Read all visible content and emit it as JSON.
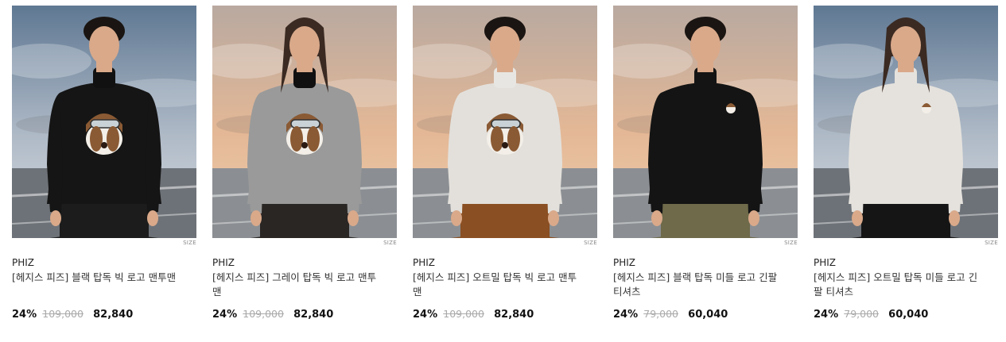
{
  "products": [
    {
      "brand": "PHIZ",
      "title": "[헤지스 피즈] 블랙 탑독 빅 로고 맨투맨",
      "discount": "24%",
      "original_price": "109,000",
      "price": "82,840",
      "size_label": "SIZE",
      "sky": "blue",
      "top_color": "#151515",
      "collar_color": "#111111",
      "bottom_color": "#1c1c1c",
      "logo": "big",
      "gender": "m"
    },
    {
      "brand": "PHIZ",
      "title": "[헤지스 피즈] 그레이 탑독 빅 로고 맨투맨",
      "discount": "24%",
      "original_price": "109,000",
      "price": "82,840",
      "size_label": "SIZE",
      "sky": "pink",
      "top_color": "#9a9a9a",
      "collar_color": "#111111",
      "bottom_color": "#2a2624",
      "logo": "big",
      "gender": "f"
    },
    {
      "brand": "PHIZ",
      "title": "[헤지스 피즈] 오트밀 탑독 빅 로고 맨투맨",
      "discount": "24%",
      "original_price": "109,000",
      "price": "82,840",
      "size_label": "SIZE",
      "sky": "pink",
      "top_color": "#e3e0db",
      "collar_color": "#e8e6e2",
      "bottom_color": "#8a4f22",
      "logo": "big",
      "gender": "m"
    },
    {
      "brand": "PHIZ",
      "title": "[헤지스 피즈] 블랙 탑독 미들 로고 긴팔 티셔츠",
      "discount": "24%",
      "original_price": "79,000",
      "price": "60,040",
      "size_label": "SIZE",
      "sky": "pink",
      "top_color": "#141414",
      "collar_color": "#141414",
      "bottom_color": "#6e6a4a",
      "logo": "small",
      "gender": "m"
    },
    {
      "brand": "PHIZ",
      "title": "[헤지스 피즈] 오트밀 탑독 미들 로고 긴팔 티셔츠",
      "discount": "24%",
      "original_price": "79,000",
      "price": "60,040",
      "size_label": "SIZE",
      "sky": "blue",
      "top_color": "#e5e2dd",
      "collar_color": "#e5e2dd",
      "bottom_color": "#151515",
      "logo": "small",
      "gender": "f"
    }
  ]
}
